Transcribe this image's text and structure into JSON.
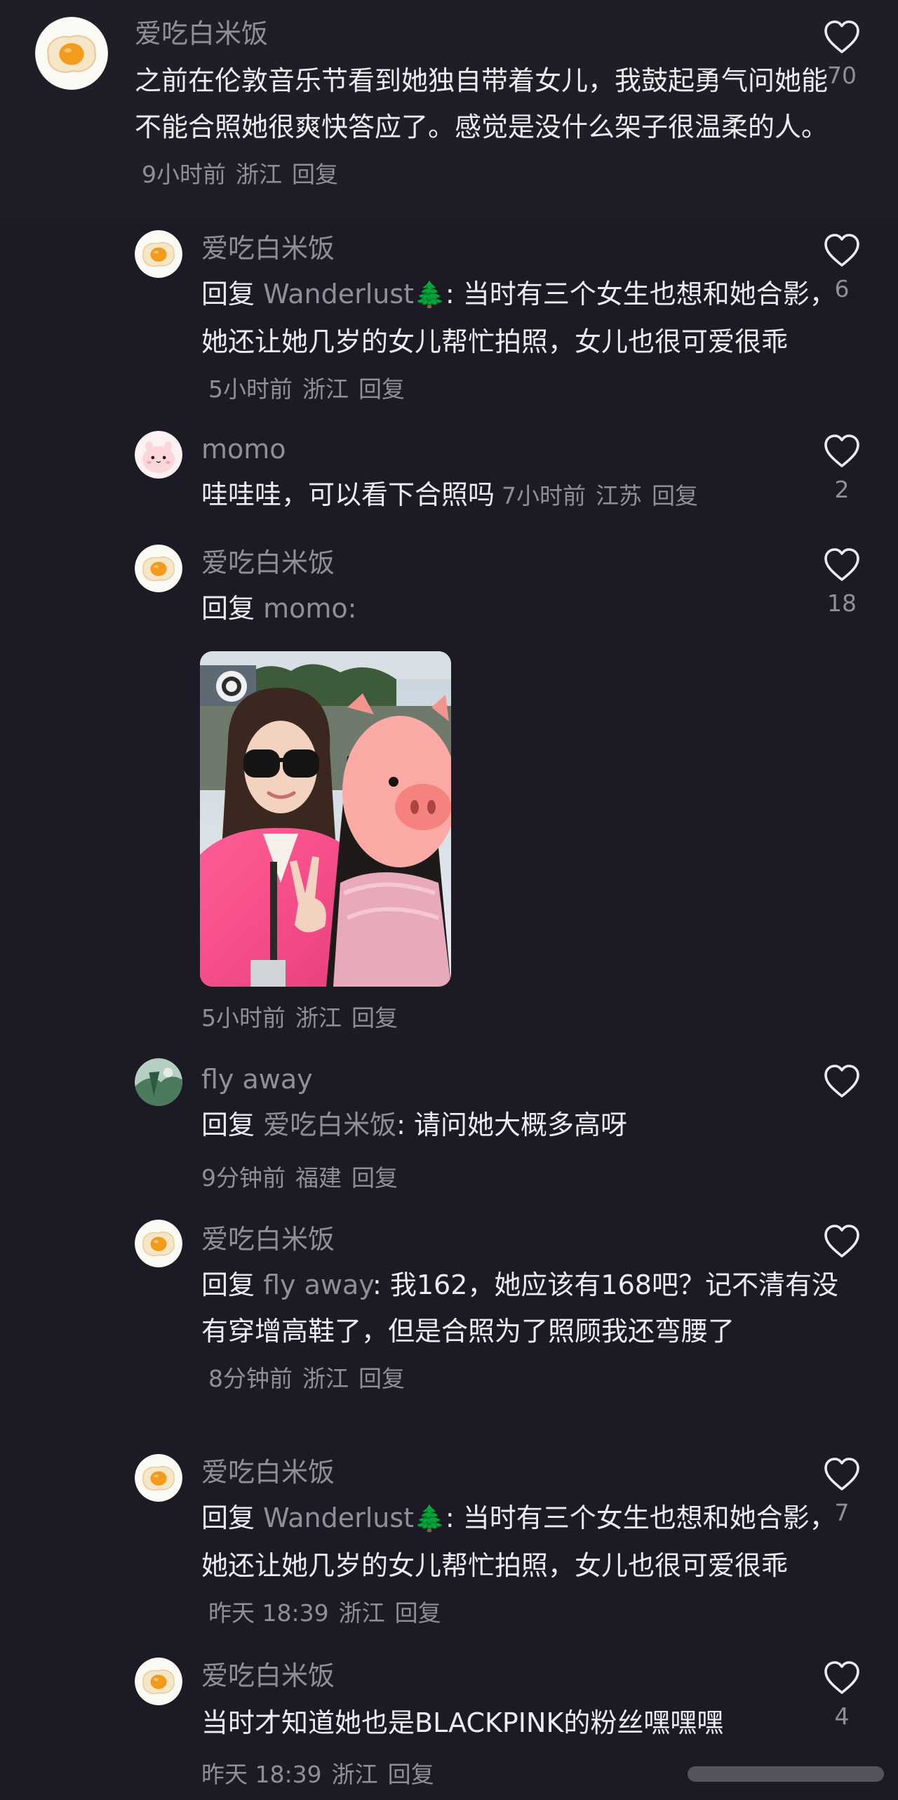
{
  "comments": [
    {
      "username": "爱吃白米饭",
      "text": "之前在伦敦音乐节看到她独自带着女儿，我鼓起勇气问她能不能合照她很爽快答应了。感觉是没什么架子很温柔的人。",
      "time": "9小时前",
      "location": "浙江",
      "reply_action": "回复",
      "likes": "70"
    },
    {
      "username": "爱吃白米饭",
      "reply_word": "回复",
      "reply_to": "Wanderlust",
      "reply_to_emoji": "🌲",
      "text": ": 当时有三个女生也想和她合影，她还让她几岁的女儿帮忙拍照，女儿也很可爱很乖",
      "time": "5小时前",
      "location": "浙江",
      "reply_action": "回复",
      "likes": "6"
    },
    {
      "username": "momo",
      "text": "哇哇哇，可以看下合照吗",
      "time": "7小时前",
      "location": "江苏",
      "reply_action": "回复",
      "likes": "2"
    },
    {
      "username": "爱吃白米饭",
      "reply_word": "回复",
      "reply_to": "momo:",
      "text": "",
      "time": "5小时前",
      "location": "浙江",
      "reply_action": "回复",
      "likes": "18"
    },
    {
      "username": "fly away",
      "reply_word": "回复",
      "reply_to": "爱吃白米饭",
      "text": ": 请问她大概多高呀",
      "time": "9分钟前",
      "location": "福建",
      "reply_action": "回复",
      "likes": ""
    },
    {
      "username": "爱吃白米饭",
      "reply_word": "回复",
      "reply_to": "fly away",
      "text": ": 我162，她应该有168吧？记不清有没有穿增高鞋了，但是合照为了照顾我还弯腰了",
      "time": "8分钟前",
      "location": "浙江",
      "reply_action": "回复",
      "likes": ""
    },
    {
      "username": "爱吃白米饭",
      "reply_word": "回复",
      "reply_to": "Wanderlust",
      "reply_to_emoji": "🌲",
      "text": ": 当时有三个女生也想和她合影，她还让她几岁的女儿帮忙拍照，女儿也很可爱很乖",
      "time": "昨天 18:39",
      "location": "浙江",
      "reply_action": "回复",
      "likes": "7"
    },
    {
      "username": "爱吃白米饭",
      "text": "当时才知道她也是BLACKPINK的粉丝嘿嘿嘿",
      "time": "昨天 18:39",
      "location": "浙江",
      "reply_action": "回复",
      "likes": "4"
    }
  ],
  "colors": {
    "background": "#1b1a25",
    "top_background": "#1f1e26",
    "text": "#ecebf0",
    "muted": "#8f8e99"
  },
  "icons": {
    "like": "heart-outline-icon",
    "tree": "evergreen-tree-emoji"
  }
}
